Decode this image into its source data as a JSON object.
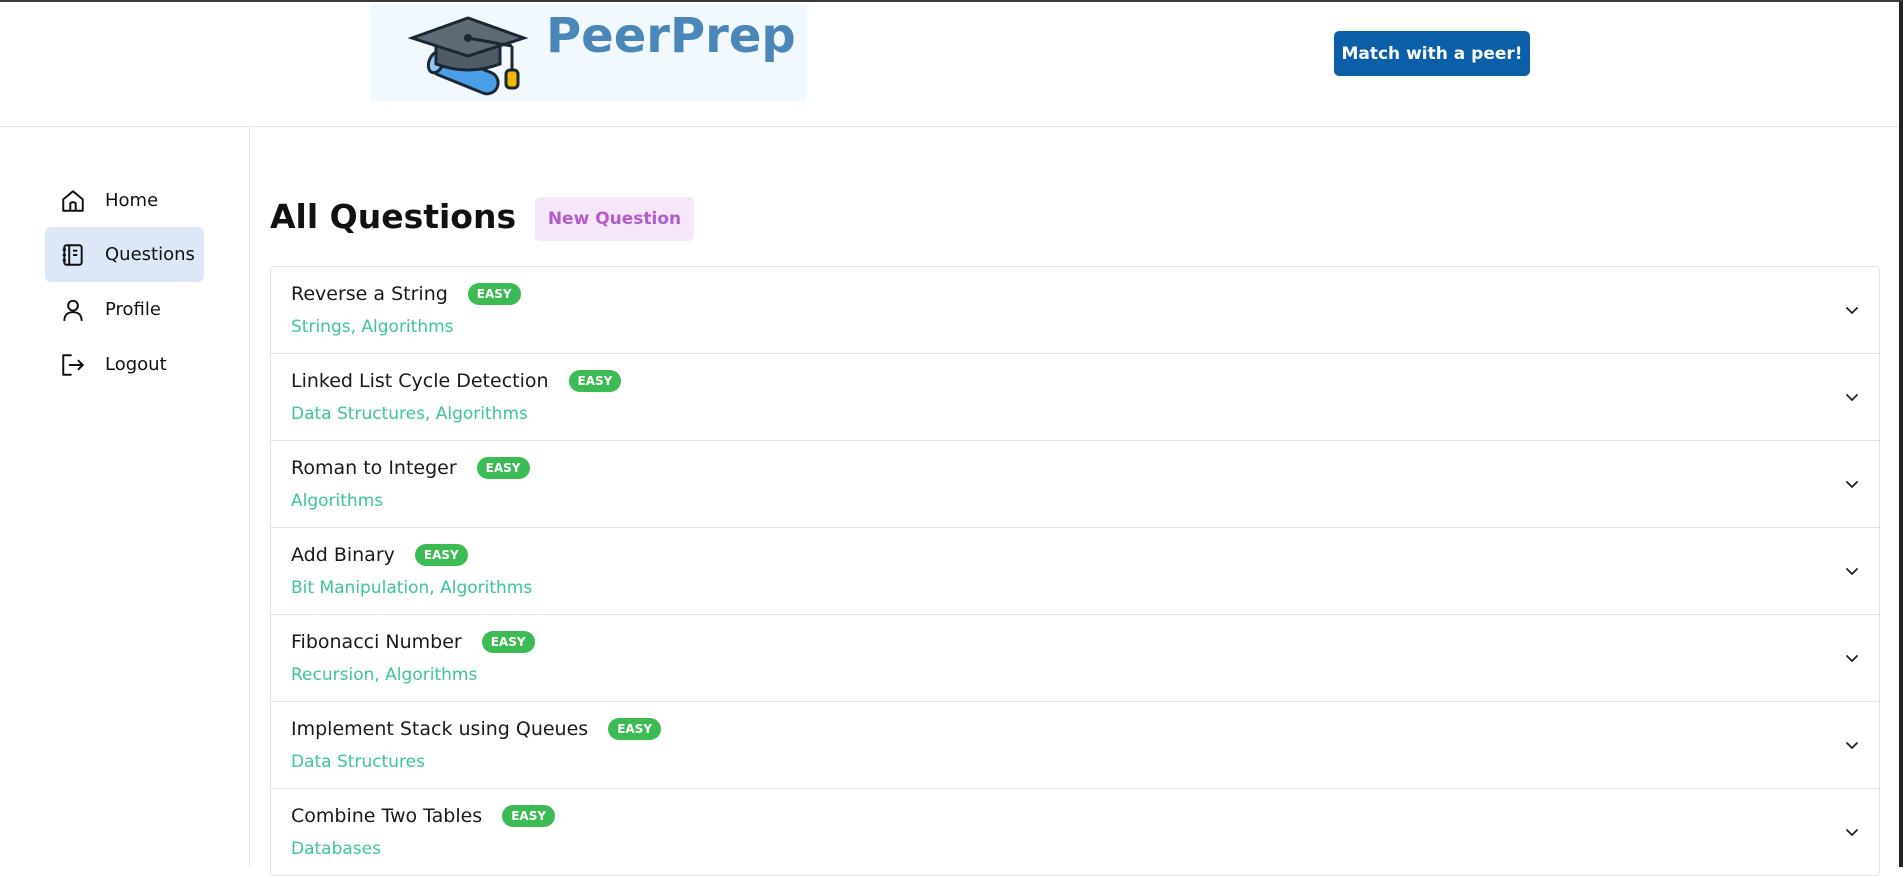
{
  "app": {
    "name": "PeerPrep"
  },
  "header": {
    "match_button": "Match with a peer!"
  },
  "sidebar": {
    "items": [
      {
        "label": "Home",
        "icon": "home-icon",
        "active": false
      },
      {
        "label": "Questions",
        "icon": "questions-icon",
        "active": true
      },
      {
        "label": "Profile",
        "icon": "user-icon",
        "active": false
      },
      {
        "label": "Logout",
        "icon": "logout-icon",
        "active": false
      }
    ]
  },
  "main": {
    "title": "All Questions",
    "new_question_button": "New Question",
    "questions": [
      {
        "title": "Reverse a String",
        "difficulty": "EASY",
        "categories": "Strings, Algorithms"
      },
      {
        "title": "Linked List Cycle Detection",
        "difficulty": "EASY",
        "categories": "Data Structures, Algorithms"
      },
      {
        "title": "Roman to Integer",
        "difficulty": "EASY",
        "categories": "Algorithms"
      },
      {
        "title": "Add Binary",
        "difficulty": "EASY",
        "categories": "Bit Manipulation, Algorithms"
      },
      {
        "title": "Fibonacci Number",
        "difficulty": "EASY",
        "categories": "Recursion, Algorithms"
      },
      {
        "title": "Implement Stack using Queues",
        "difficulty": "EASY",
        "categories": "Data Structures"
      },
      {
        "title": "Combine Two Tables",
        "difficulty": "EASY",
        "categories": "Databases"
      }
    ]
  },
  "colors": {
    "primary_button": "#0b5ea8",
    "easy_badge": "#3cba54",
    "category_text": "#3cc4a0",
    "active_nav": "#dce8f7",
    "new_question_bg": "#f6e6f9",
    "new_question_text": "#b25ccc"
  }
}
